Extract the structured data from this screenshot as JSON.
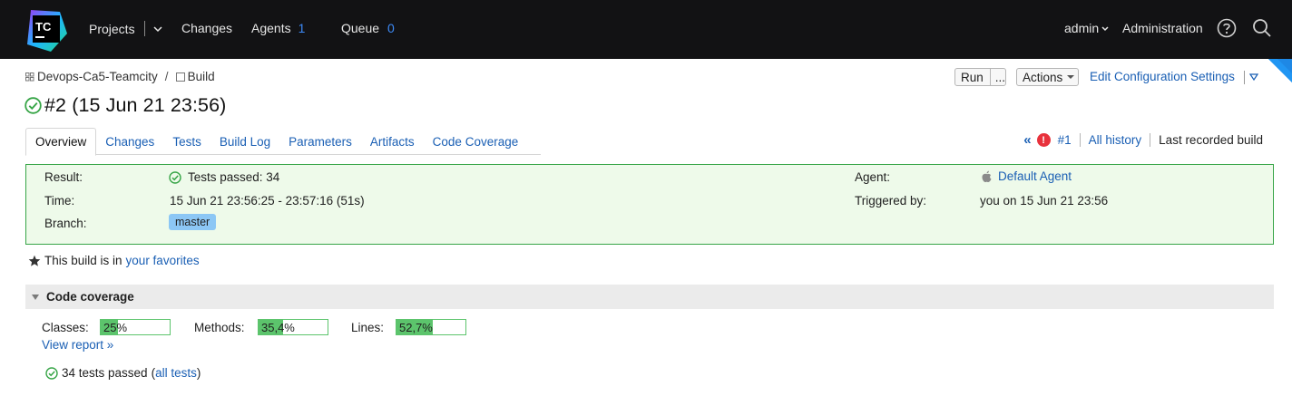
{
  "topbar": {
    "logo_text": "TC",
    "projects_label": "Projects",
    "changes_label": "Changes",
    "agents_label": "Agents",
    "agents_count": "1",
    "queue_label": "Queue",
    "queue_count": "0",
    "user_label": "admin",
    "administration_label": "Administration",
    "help_icon": "help-circle-icon",
    "search_icon": "search-icon"
  },
  "breadcrumb": {
    "project": "Devops-Ca5-Teamcity",
    "separator": "/",
    "build_config": "Build"
  },
  "toolbar": {
    "run_label": "Run",
    "run_more_label": "...",
    "actions_label": "Actions",
    "edit_settings_label": "Edit Configuration Settings"
  },
  "build": {
    "title": "#2 (15 Jun 21 23:56)",
    "status": "success"
  },
  "tabs": [
    {
      "label": "Overview",
      "active": true
    },
    {
      "label": "Changes"
    },
    {
      "label": "Tests"
    },
    {
      "label": "Build Log"
    },
    {
      "label": "Parameters"
    },
    {
      "label": "Artifacts"
    },
    {
      "label": "Code Coverage"
    }
  ],
  "history": {
    "prev_build": "#1",
    "all_history": "All history",
    "last_recorded": "Last recorded build"
  },
  "summary": {
    "result_label": "Result:",
    "result_value": "Tests passed: 34",
    "time_label": "Time:",
    "time_value": "15 Jun 21 23:56:25 - 23:57:16 (51s)",
    "branch_label": "Branch:",
    "branch_value": "master",
    "agent_label": "Agent:",
    "agent_value": "Default Agent",
    "triggered_label": "Triggered by:",
    "triggered_value": "you on 15 Jun 21 23:56"
  },
  "favorites": {
    "text": "This build is in",
    "link": "your favorites"
  },
  "coverage": {
    "header": "Code coverage",
    "classes_label": "Classes:",
    "classes_value": "25%",
    "classes_fraction": 0.25,
    "methods_label": "Methods:",
    "methods_value": "35,4%",
    "methods_fraction": 0.354,
    "lines_label": "Lines:",
    "lines_value": "52,7%",
    "lines_fraction": 0.527,
    "view_report": "View report »"
  },
  "tests": {
    "text": "34 tests passed",
    "paren_open": "(",
    "link": "all tests",
    "paren_close": ")"
  },
  "colors": {
    "topbar_bg": "#121214",
    "accent_blue": "#1a5fb4",
    "success_green": "#37a547",
    "error_red": "#e8323c"
  }
}
